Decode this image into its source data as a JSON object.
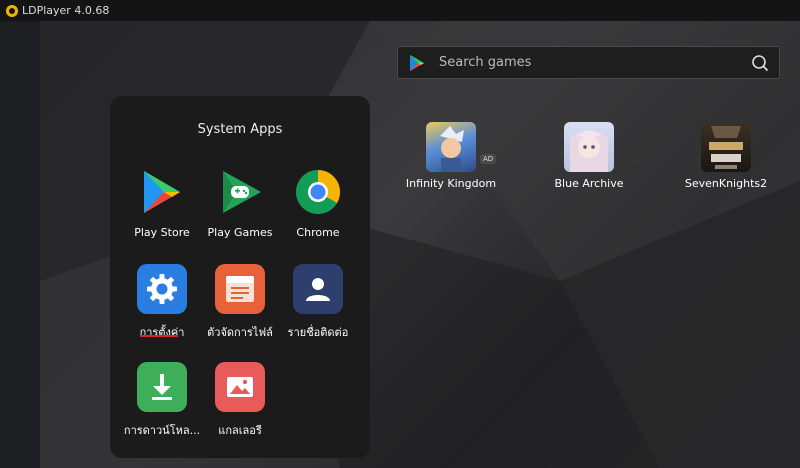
{
  "window": {
    "title": "LDPlayer 4.0.68"
  },
  "search": {
    "placeholder": "Search games"
  },
  "system_apps": {
    "title": "System Apps",
    "apps": [
      {
        "label": "Play Store",
        "icon": "play-store-icon"
      },
      {
        "label": "Play Games",
        "icon": "play-games-icon"
      },
      {
        "label": "Chrome",
        "icon": "chrome-icon"
      },
      {
        "label": "การตั้งค่า",
        "icon": "settings-gear-icon"
      },
      {
        "label": "ตัวจัดการไฟล์",
        "icon": "file-manager-icon"
      },
      {
        "label": "รายชื่อติดต่อ",
        "icon": "contacts-icon"
      },
      {
        "label": "การดาวน์โหล...",
        "icon": "download-icon"
      },
      {
        "label": "แกลเลอรี",
        "icon": "gallery-icon"
      }
    ]
  },
  "games": [
    {
      "label": "Infinity Kingdom",
      "badge": "AD"
    },
    {
      "label": "Blue Archive"
    },
    {
      "label": "SevenKnights2"
    }
  ],
  "colors": {
    "titlebar": "#141414",
    "panel": "#1b1b1b",
    "settings": "#2a7de1",
    "file_manager": "#e8613a",
    "contacts": "#2e3f6e",
    "download": "#3fae5b",
    "gallery": "#e85b5b",
    "highlight_underline": "#e02020"
  }
}
